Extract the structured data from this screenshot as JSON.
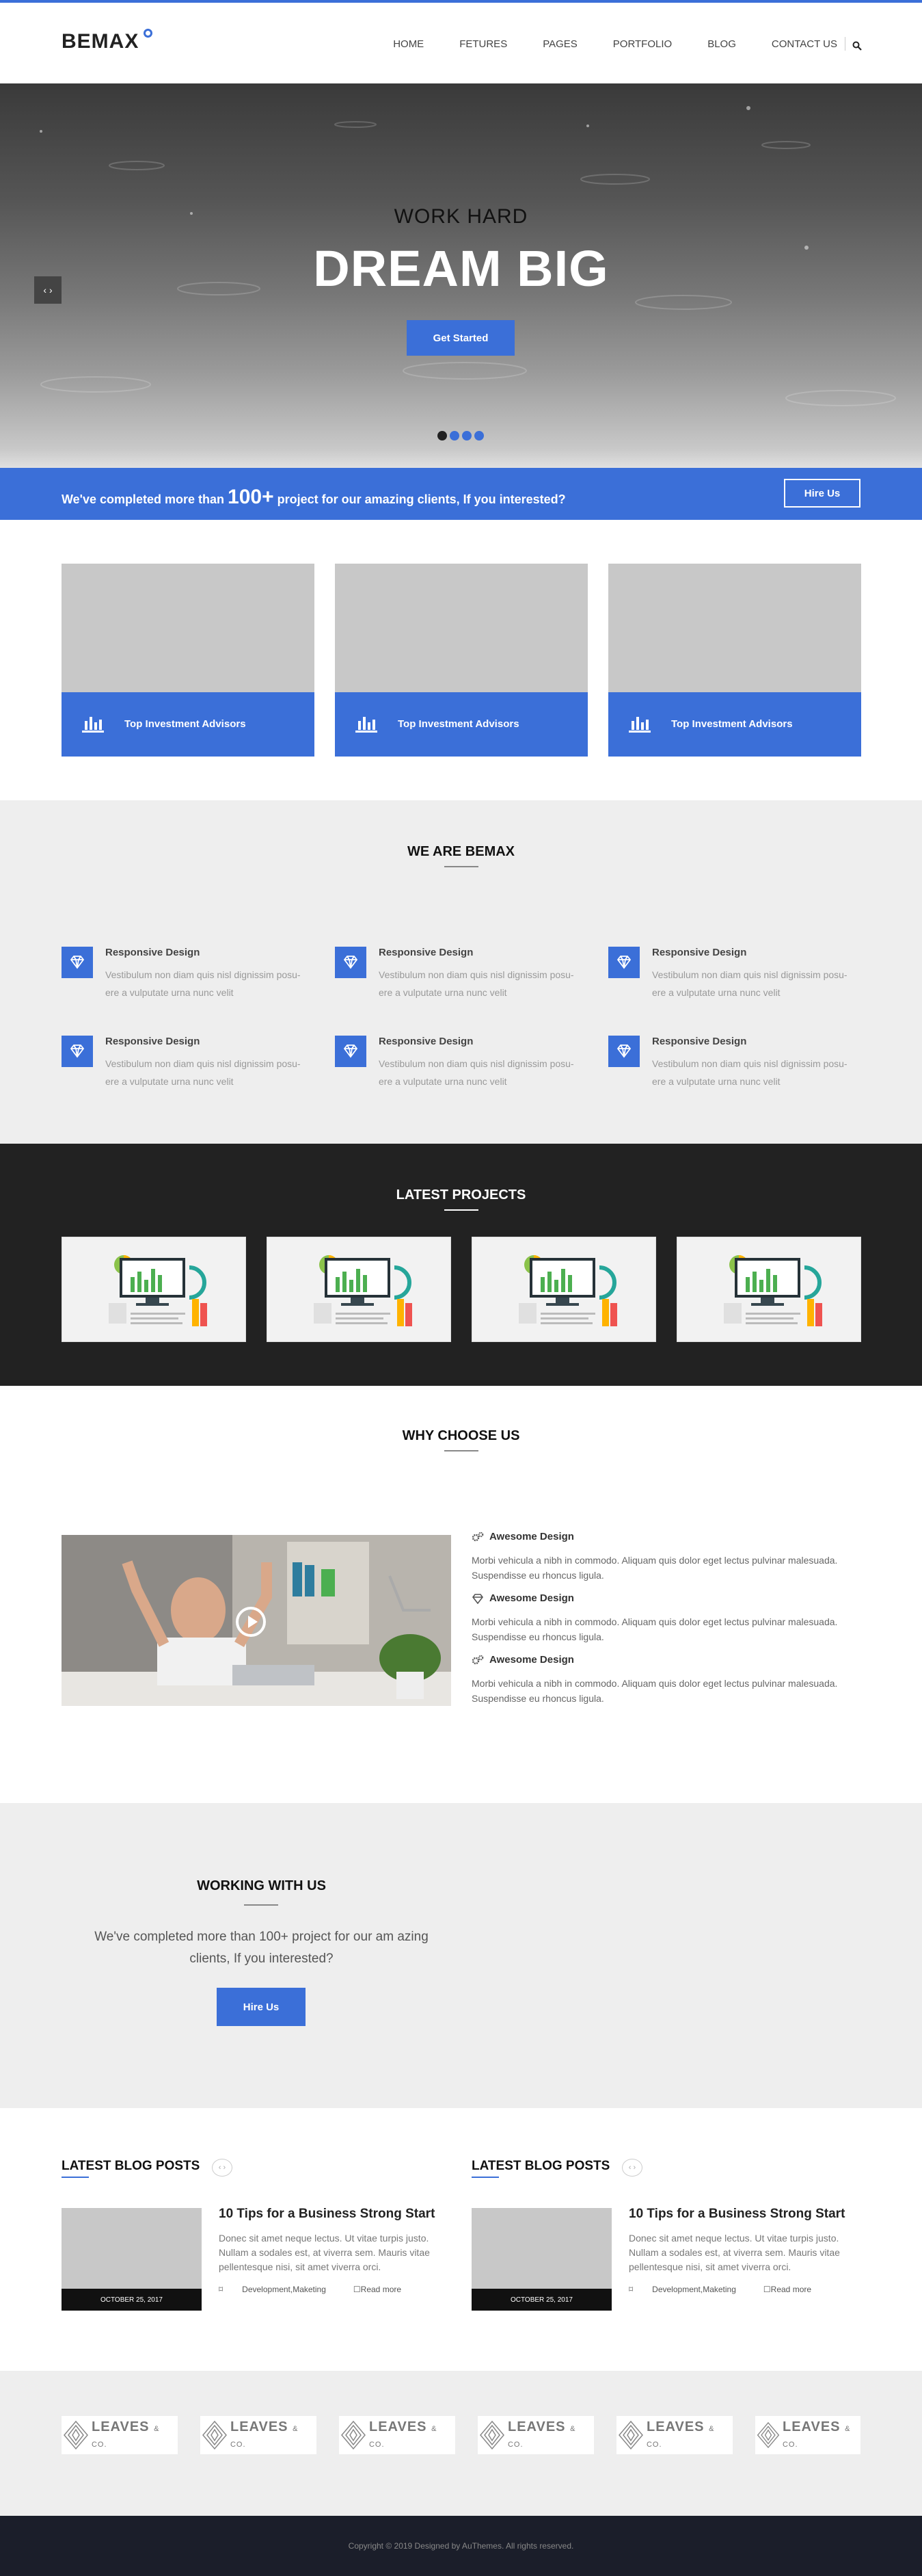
{
  "brand": {
    "logo": "BEMAX",
    "accent": "#3b6fd8"
  },
  "nav": {
    "items": [
      "HOME",
      "FETURES",
      "PAGES",
      "PORTFOLIO",
      "BLOG",
      "CONTACT US"
    ]
  },
  "hero": {
    "line1": "WORK HARD",
    "line2": "DREAM BIG",
    "cta": "Get Started",
    "arrow": "‹ ›",
    "slides": 4,
    "active_slide": 1
  },
  "promo": {
    "prefix": "We've completed more than ",
    "highlight": "100+",
    "suffix": " project for our amazing clients, If you interested?",
    "button": "Hire Us"
  },
  "cards": [
    {
      "label": "Top Investment Advisors"
    },
    {
      "label": "Top Investment Advisors"
    },
    {
      "label": "Top Investment Advisors"
    }
  ],
  "about": {
    "title": "WE ARE BEMAX",
    "features": [
      {
        "title": "Responsive Design",
        "text": "Vestibulum non diam quis nisl dignissim posu- ere a vulputate urna nunc velit"
      },
      {
        "title": "Responsive Design",
        "text": "Vestibulum non diam quis nisl dignissim posu- ere a vulputate urna nunc velit"
      },
      {
        "title": "Responsive Design",
        "text": "Vestibulum non diam quis nisl dignissim posu- ere a vulputate urna nunc velit"
      },
      {
        "title": "Responsive Design",
        "text": "Vestibulum non diam quis nisl dignissim posu- ere a vulputate urna nunc velit"
      },
      {
        "title": "Responsive Design",
        "text": "Vestibulum non diam quis nisl dignissim posu- ere a vulputate urna nunc velit"
      },
      {
        "title": "Responsive Design",
        "text": "Vestibulum non diam quis nisl dignissim posu- ere a vulputate urna nunc velit"
      }
    ]
  },
  "projects": {
    "title": "LATEST PROJECTS",
    "count": 4
  },
  "why": {
    "title": "WHY CHOOSE US",
    "items": [
      {
        "icon": "gears-icon",
        "title": "Awesome Design",
        "text": "Morbi vehicula a nibh in commodo. Aliquam quis dolor eget lectus pulvinar malesuada. Suspendisse eu rhoncus ligula."
      },
      {
        "icon": "diamond-icon",
        "title": "Awesome Design",
        "text": "Morbi vehicula a nibh in commodo. Aliquam quis dolor eget lectus pulvinar malesuada. Suspendisse eu rhoncus ligula."
      },
      {
        "icon": "gears-icon",
        "title": "Awesome Design",
        "text": "Morbi vehicula a nibh in commodo. Aliquam quis dolor eget lectus pulvinar malesuada. Suspendisse eu rhoncus ligula."
      }
    ]
  },
  "working": {
    "title": "WORKING WITH US",
    "text": "We've completed more than 100+ project for our am azing clients, If you interested?",
    "button": "Hire Us"
  },
  "blog": [
    {
      "heading": "LATEST BLOG POSTS",
      "nav": "‹ ›",
      "date": "OCTOBER 25, 2017",
      "title": "10 Tips for a Business Strong Start",
      "text": "Donec sit amet neque lectus. Ut vitae turpis justo. Nullam a sodales est, at viverra sem. Mauris vitae pellentesque nisi, sit amet viverra orci.",
      "tags": "Development,Maketing",
      "more": "Read more"
    },
    {
      "heading": "LATEST BLOG POSTS",
      "nav": "‹ ›",
      "date": "OCTOBER 25, 2017",
      "title": "10 Tips for a Business Strong Start",
      "text": "Donec sit amet neque lectus. Ut vitae turpis justo. Nullam a sodales est, at viverra sem. Mauris vitae pellentesque nisi, sit amet viverra orci.",
      "tags": "Development,Maketing",
      "more": "Read more"
    }
  ],
  "clients": {
    "name": "LEAVES",
    "suffix": "& CO.",
    "count": 6
  },
  "footer": {
    "copyright": "Copyright © 2019 Designed by AuThemes. All rights reserved."
  }
}
